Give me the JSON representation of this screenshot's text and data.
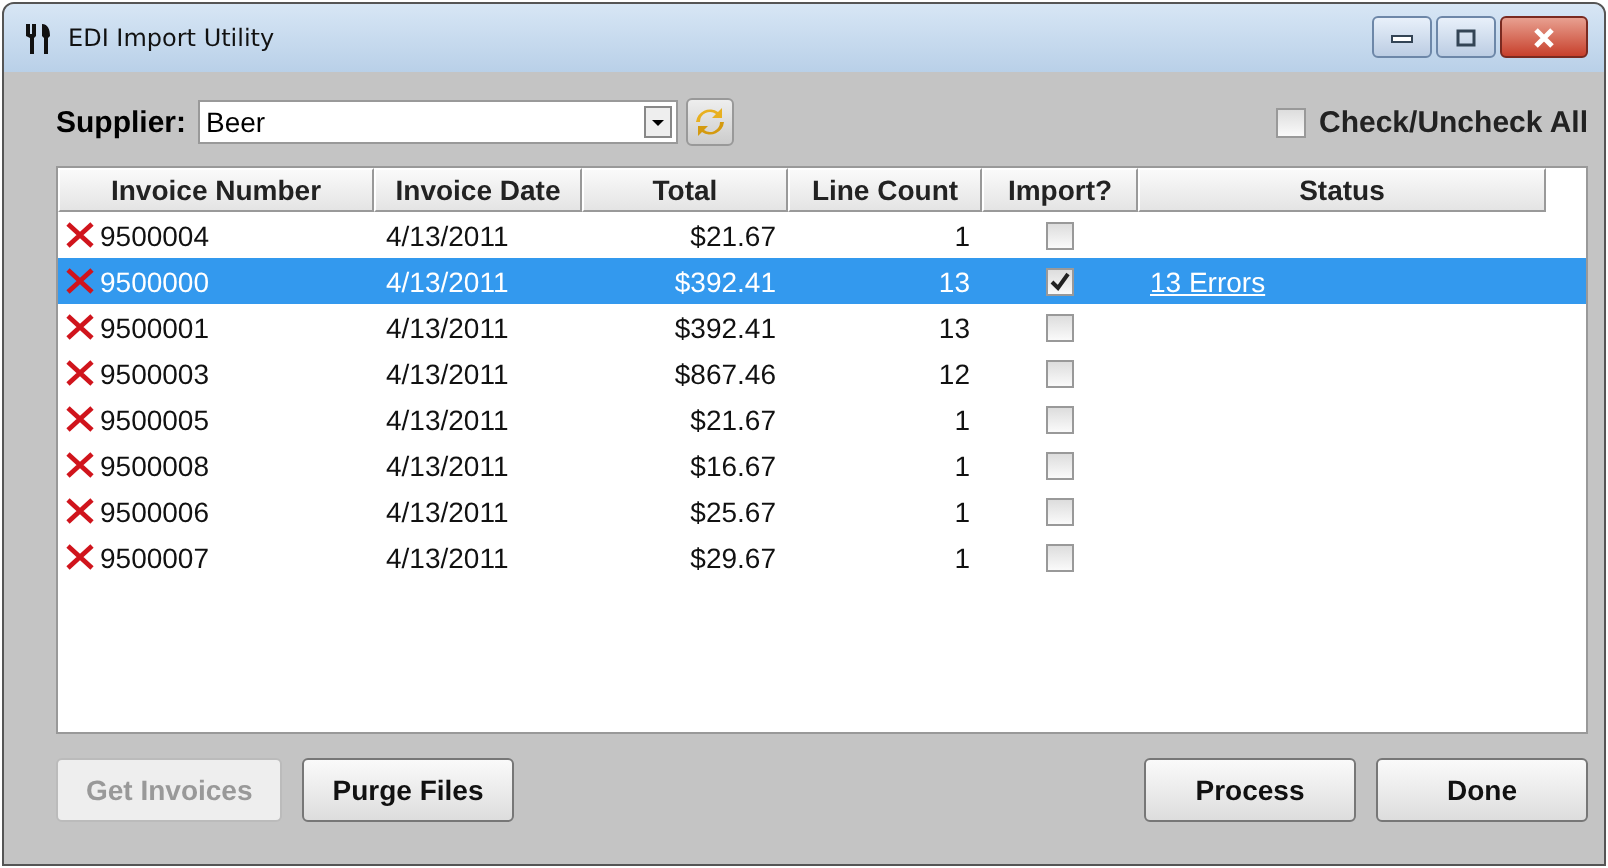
{
  "window": {
    "title": "EDI Import Utility"
  },
  "supplier": {
    "label": "Supplier:",
    "value": "Beer"
  },
  "check_all": {
    "label": "Check/Uncheck All",
    "checked": false
  },
  "table": {
    "columns": [
      "Invoice Number",
      "Invoice Date",
      "Total",
      "Line Count",
      "Import?",
      "Status"
    ],
    "rows": [
      {
        "number": "9500004",
        "date": "4/13/2011",
        "total": "$21.67",
        "line_count": "1",
        "import": false,
        "has_errors": true,
        "selected": false
      },
      {
        "number": "9500000",
        "date": "4/13/2011",
        "total": "$392.41",
        "line_count": "13",
        "import": true,
        "has_errors": true,
        "selected": true,
        "status": "13 Errors"
      },
      {
        "number": "9500001",
        "date": "4/13/2011",
        "total": "$392.41",
        "line_count": "13",
        "import": false,
        "has_errors": true,
        "selected": false
      },
      {
        "number": "9500003",
        "date": "4/13/2011",
        "total": "$867.46",
        "line_count": "12",
        "import": false,
        "has_errors": true,
        "selected": false
      },
      {
        "number": "9500005",
        "date": "4/13/2011",
        "total": "$21.67",
        "line_count": "1",
        "import": false,
        "has_errors": true,
        "selected": false
      },
      {
        "number": "9500008",
        "date": "4/13/2011",
        "total": "$16.67",
        "line_count": "1",
        "import": false,
        "has_errors": true,
        "selected": false
      },
      {
        "number": "9500006",
        "date": "4/13/2011",
        "total": "$25.67",
        "line_count": "1",
        "import": false,
        "has_errors": true,
        "selected": false
      },
      {
        "number": "9500007",
        "date": "4/13/2011",
        "total": "$29.67",
        "line_count": "1",
        "import": false,
        "has_errors": true,
        "selected": false
      }
    ]
  },
  "buttons_left": [
    {
      "label": "Get Invoices",
      "disabled": true
    },
    {
      "label": "Purge Files",
      "disabled": false
    }
  ],
  "buttons_right": [
    {
      "label": "Process",
      "disabled": false
    },
    {
      "label": "Done",
      "disabled": false
    }
  ]
}
